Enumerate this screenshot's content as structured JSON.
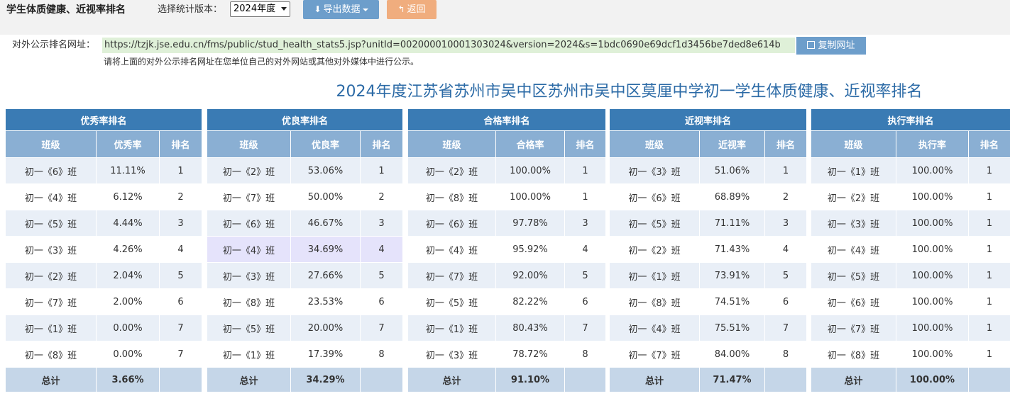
{
  "header": {
    "title": "学生体质健康、近视率排名",
    "version_label": "选择统计版本：",
    "version_selected": "2024年度",
    "export_label": "导出数据",
    "back_label": "返回"
  },
  "publish": {
    "url_label": "对外公示排名网址：",
    "url": "https://tzjk.jse.edu.cn/fms/public/stud_health_stats5.jsp?unitId=002000010001303024&version=2024&s=1bdc0690e69dcf1d3456be7ded8e614b",
    "copy_label": "复制网址",
    "note": "请将上面的对外公示排名网址在您单位自己的对外网站或其他对外媒体中进行公示。"
  },
  "page_title": "2024年度江苏省苏州市吴中区苏州市吴中区莫厘中学初一学生体质健康、近视率排名",
  "tables": [
    {
      "title": "优秀率排名",
      "col_class": "班级",
      "col_rate": "优秀率",
      "col_rank": "排名",
      "rows": [
        {
          "class": "初一《6》班",
          "rate": "11.11%",
          "rank": "1"
        },
        {
          "class": "初一《4》班",
          "rate": "6.12%",
          "rank": "2"
        },
        {
          "class": "初一《5》班",
          "rate": "4.44%",
          "rank": "3"
        },
        {
          "class": "初一《3》班",
          "rate": "4.26%",
          "rank": "4"
        },
        {
          "class": "初一《2》班",
          "rate": "2.04%",
          "rank": "5"
        },
        {
          "class": "初一《7》班",
          "rate": "2.00%",
          "rank": "6"
        },
        {
          "class": "初一《1》班",
          "rate": "0.00%",
          "rank": "7"
        },
        {
          "class": "初一《8》班",
          "rate": "0.00%",
          "rank": "7"
        }
      ],
      "total_label": "总计",
      "total_value": "3.66%"
    },
    {
      "title": "优良率排名",
      "col_class": "班级",
      "col_rate": "优良率",
      "col_rank": "排名",
      "rows": [
        {
          "class": "初一《2》班",
          "rate": "53.06%",
          "rank": "1"
        },
        {
          "class": "初一《7》班",
          "rate": "50.00%",
          "rank": "2"
        },
        {
          "class": "初一《6》班",
          "rate": "46.67%",
          "rank": "3"
        },
        {
          "class": "初一《4》班",
          "rate": "34.69%",
          "rank": "4"
        },
        {
          "class": "初一《3》班",
          "rate": "27.66%",
          "rank": "5"
        },
        {
          "class": "初一《8》班",
          "rate": "23.53%",
          "rank": "6"
        },
        {
          "class": "初一《5》班",
          "rate": "20.00%",
          "rank": "7"
        },
        {
          "class": "初一《1》班",
          "rate": "17.39%",
          "rank": "8"
        }
      ],
      "total_label": "总计",
      "total_value": "34.29%"
    },
    {
      "title": "合格率排名",
      "col_class": "班级",
      "col_rate": "合格率",
      "col_rank": "排名",
      "rows": [
        {
          "class": "初一《2》班",
          "rate": "100.00%",
          "rank": "1"
        },
        {
          "class": "初一《8》班",
          "rate": "100.00%",
          "rank": "1"
        },
        {
          "class": "初一《6》班",
          "rate": "97.78%",
          "rank": "3"
        },
        {
          "class": "初一《4》班",
          "rate": "95.92%",
          "rank": "4"
        },
        {
          "class": "初一《7》班",
          "rate": "92.00%",
          "rank": "5"
        },
        {
          "class": "初一《5》班",
          "rate": "82.22%",
          "rank": "6"
        },
        {
          "class": "初一《1》班",
          "rate": "80.43%",
          "rank": "7"
        },
        {
          "class": "初一《3》班",
          "rate": "78.72%",
          "rank": "8"
        }
      ],
      "total_label": "总计",
      "total_value": "91.10%"
    },
    {
      "title": "近视率排名",
      "col_class": "班级",
      "col_rate": "近视率",
      "col_rank": "排名",
      "rows": [
        {
          "class": "初一《3》班",
          "rate": "51.06%",
          "rank": "1"
        },
        {
          "class": "初一《6》班",
          "rate": "68.89%",
          "rank": "2"
        },
        {
          "class": "初一《5》班",
          "rate": "71.11%",
          "rank": "3"
        },
        {
          "class": "初一《2》班",
          "rate": "71.43%",
          "rank": "4"
        },
        {
          "class": "初一《1》班",
          "rate": "73.91%",
          "rank": "5"
        },
        {
          "class": "初一《8》班",
          "rate": "74.51%",
          "rank": "6"
        },
        {
          "class": "初一《4》班",
          "rate": "75.51%",
          "rank": "7"
        },
        {
          "class": "初一《7》班",
          "rate": "84.00%",
          "rank": "8"
        }
      ],
      "total_label": "总计",
      "total_value": "71.47%"
    },
    {
      "title": "执行率排名",
      "col_class": "班级",
      "col_rate": "执行率",
      "col_rank": "排名",
      "rows": [
        {
          "class": "初一《1》班",
          "rate": "100.00%",
          "rank": "1"
        },
        {
          "class": "初一《2》班",
          "rate": "100.00%",
          "rank": "1"
        },
        {
          "class": "初一《3》班",
          "rate": "100.00%",
          "rank": "1"
        },
        {
          "class": "初一《4》班",
          "rate": "100.00%",
          "rank": "1"
        },
        {
          "class": "初一《5》班",
          "rate": "100.00%",
          "rank": "1"
        },
        {
          "class": "初一《6》班",
          "rate": "100.00%",
          "rank": "1"
        },
        {
          "class": "初一《7》班",
          "rate": "100.00%",
          "rank": "1"
        },
        {
          "class": "初一《8》班",
          "rate": "100.00%",
          "rank": "1"
        }
      ],
      "total_label": "总计",
      "total_value": "100.00%"
    }
  ],
  "highlight": {
    "table_index": 1,
    "row_index": 3
  },
  "colors": {
    "header_dark": "#3a7bb4",
    "header_light": "#8aafd3",
    "row_alt": "#e9eff7",
    "total_row": "#c5d6e8",
    "title_blue": "#2b6aa6",
    "url_bg": "#dff0d8",
    "export_btn": "#6d9ecb",
    "back_btn": "#f0ad7e"
  }
}
